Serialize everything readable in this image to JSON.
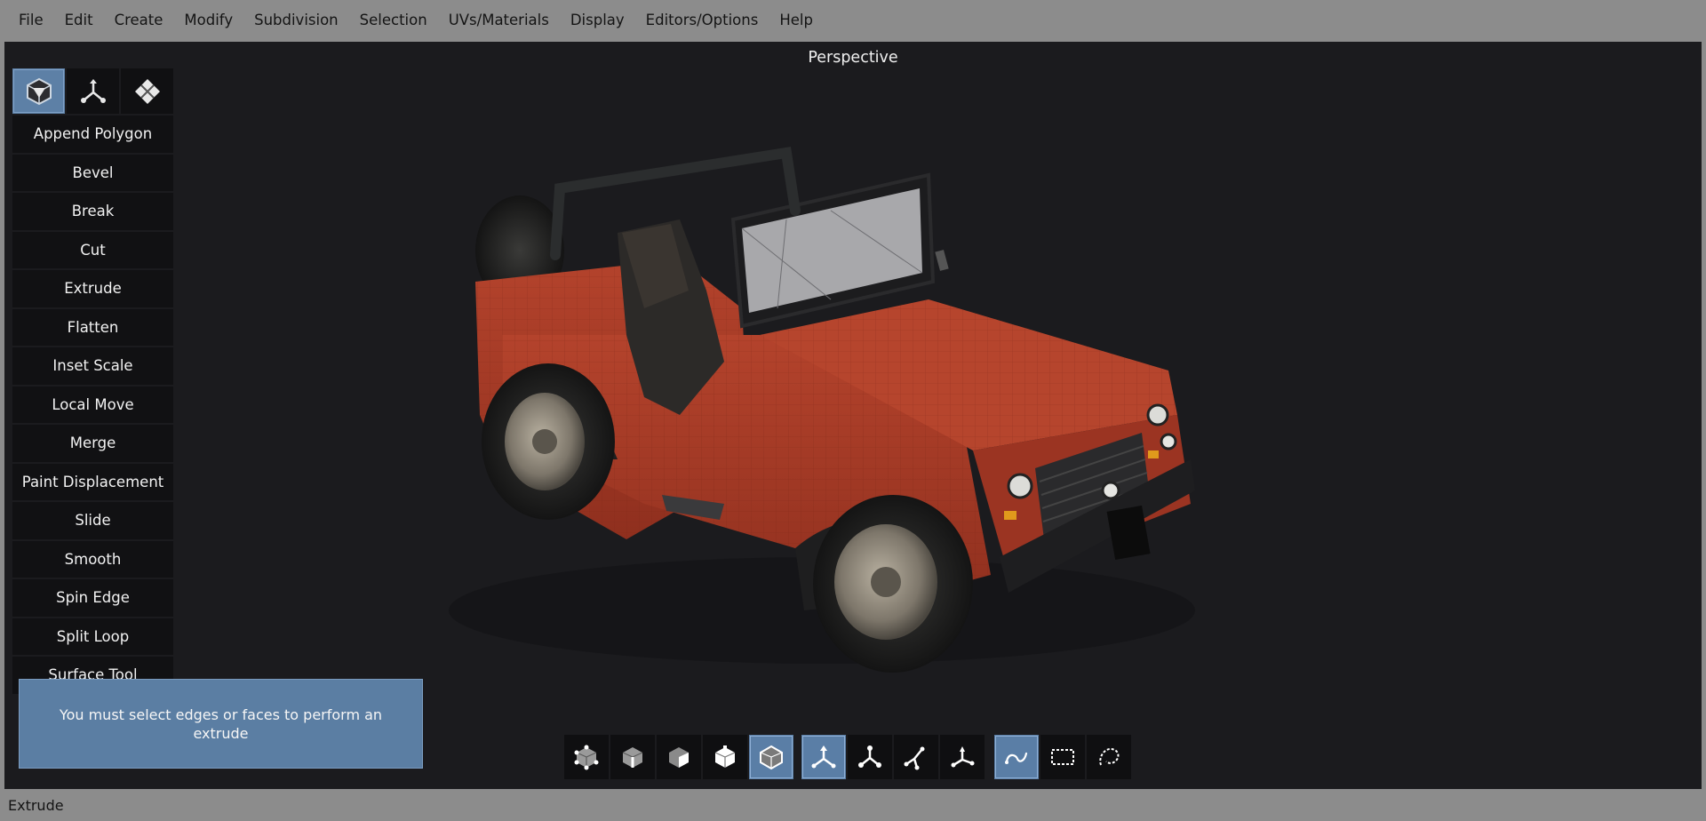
{
  "menu": [
    "File",
    "Edit",
    "Create",
    "Modify",
    "Subdivision",
    "Selection",
    "UVs/Materials",
    "Display",
    "Editors/Options",
    "Help"
  ],
  "viewport": {
    "title": "Perspective"
  },
  "mode_icons": [
    "polygon-mode-icon",
    "transform-mode-icon",
    "uv-mode-icon"
  ],
  "tools": [
    "Append Polygon",
    "Bevel",
    "Break",
    "Cut",
    "Extrude",
    "Flatten",
    "Inset Scale",
    "Local Move",
    "Merge",
    "Paint Displacement",
    "Slide",
    "Smooth",
    "Spin Edge",
    "Split Loop",
    "Surface Tool"
  ],
  "toast": {
    "message": "You must select edges or faces to perform an extrude"
  },
  "status": {
    "text": "Extrude"
  },
  "bottom_toolbar": {
    "component_modes": [
      "vertex-select-icon",
      "edge-select-icon",
      "face-select-icon",
      "uv-shell-select-icon",
      "object-select-icon"
    ],
    "axis_modes": [
      "world-axis-icon",
      "object-axis-icon",
      "local-axis-icon",
      "screen-axis-icon"
    ],
    "selection_modes": [
      "lasso-select-icon",
      "box-select-icon",
      "freeform-select-icon"
    ],
    "active": [
      "object-select-icon",
      "world-axis-icon",
      "lasso-select-icon"
    ]
  },
  "colors": {
    "accent": "#5b7ea3",
    "viewport_bg": "#1b1b1e",
    "chrome": "#8c8c8c",
    "jeep_body": "#a83a25"
  }
}
